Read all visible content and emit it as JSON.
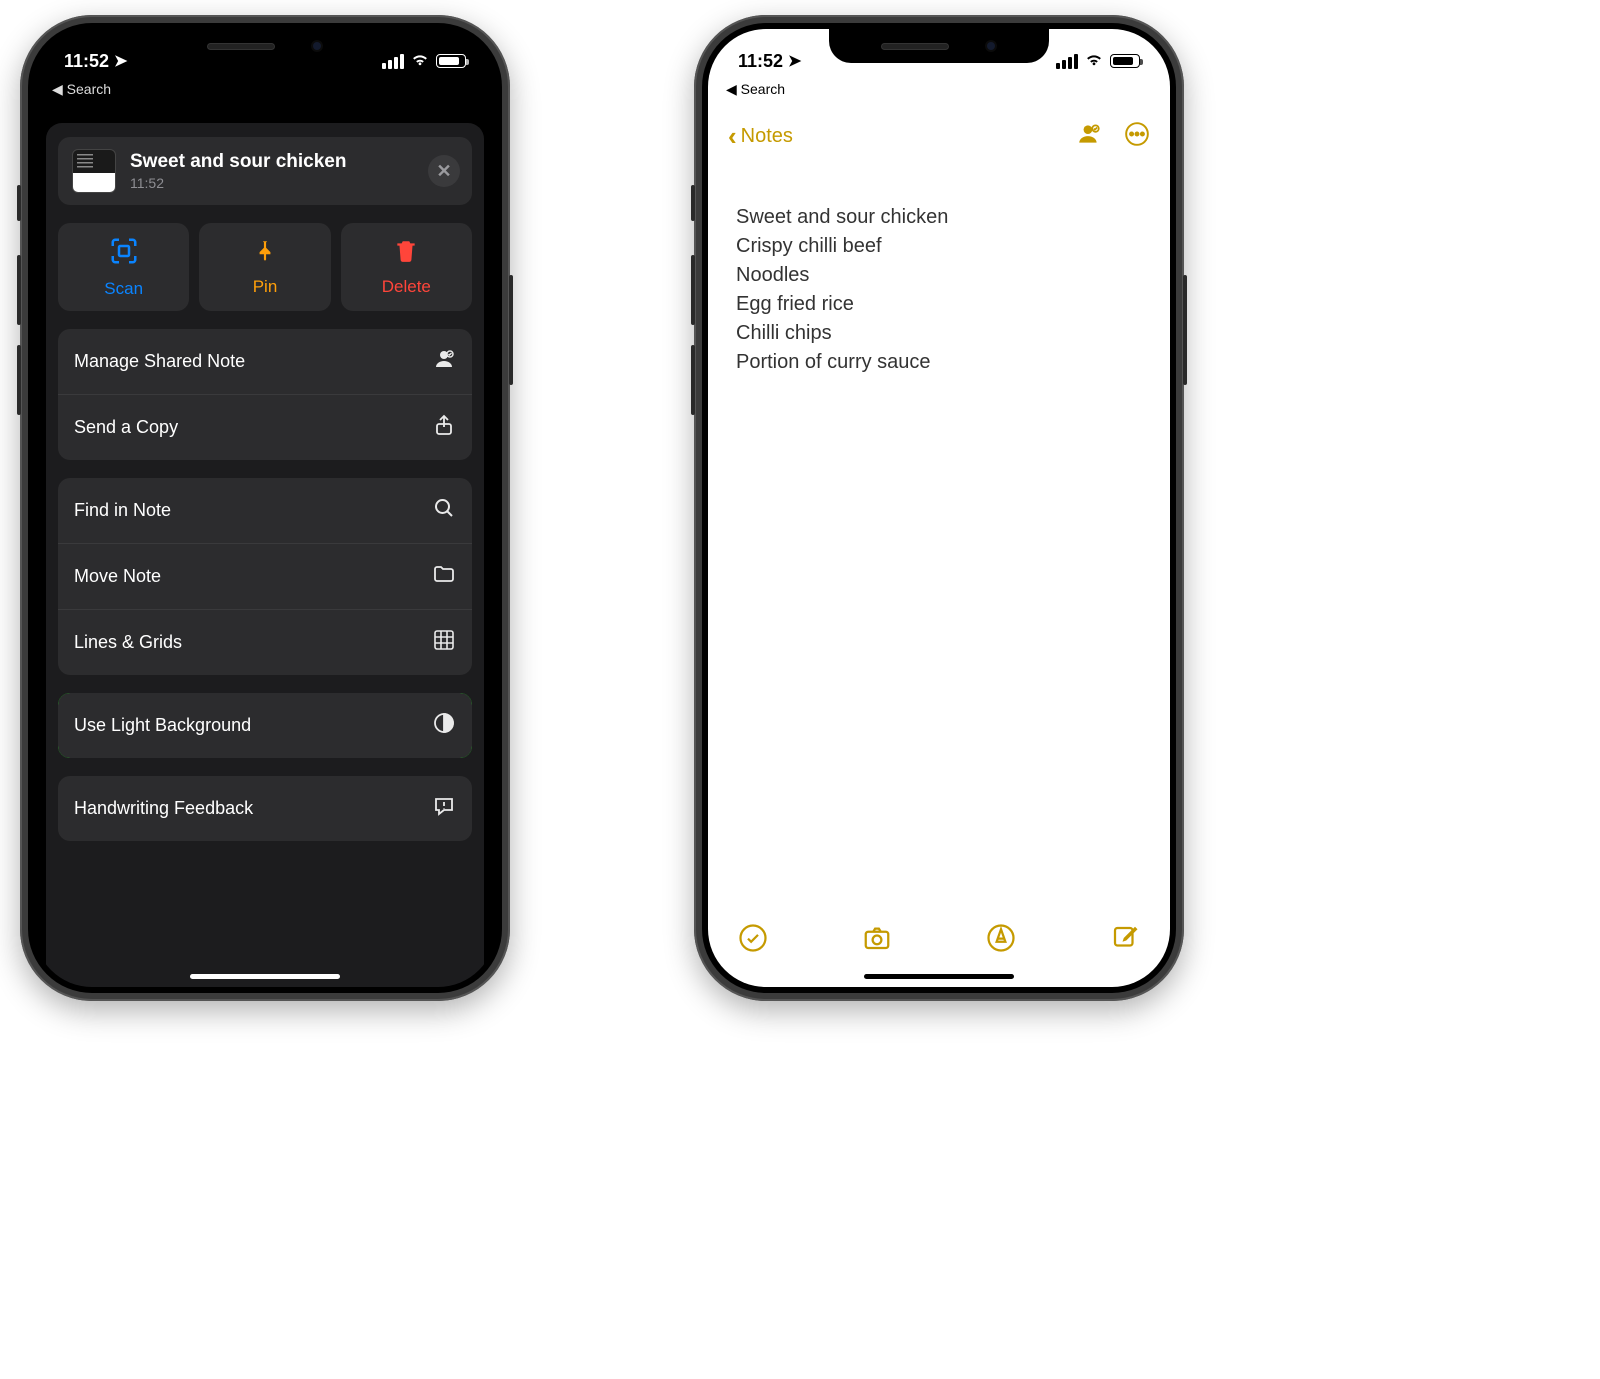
{
  "status": {
    "time": "11:52",
    "back_label": "Search",
    "battery_pct": 78
  },
  "dark": {
    "sheet_title": "Sweet and sour chicken",
    "sheet_time": "11:52",
    "actions": [
      {
        "icon": "scan",
        "label": "Scan"
      },
      {
        "icon": "pin",
        "label": "Pin"
      },
      {
        "icon": "delete",
        "label": "Delete"
      }
    ],
    "group1": [
      {
        "label": "Manage Shared Note",
        "icon": "shared"
      },
      {
        "label": "Send a Copy",
        "icon": "share"
      }
    ],
    "group2": [
      {
        "label": "Find in Note",
        "icon": "search"
      },
      {
        "label": "Move Note",
        "icon": "folder"
      },
      {
        "label": "Lines & Grids",
        "icon": "grid"
      }
    ],
    "group3": [
      {
        "label": "Use Light Background",
        "icon": "contrast",
        "highlight": true
      }
    ],
    "group4": [
      {
        "label": "Handwriting Feedback",
        "icon": "feedback"
      }
    ]
  },
  "light": {
    "nav_back": "Notes",
    "note_lines": [
      "Sweet and sour chicken",
      "Crispy chilli beef",
      "Noodles",
      "Egg fried rice",
      "Chilli chips",
      "Portion of curry sauce"
    ]
  },
  "colors": {
    "notes_accent": "#c59a00",
    "ios_blue": "#0a84ff",
    "ios_orange": "#ff9f0a",
    "ios_red": "#ff453a",
    "highlight_green": "#18e818"
  }
}
